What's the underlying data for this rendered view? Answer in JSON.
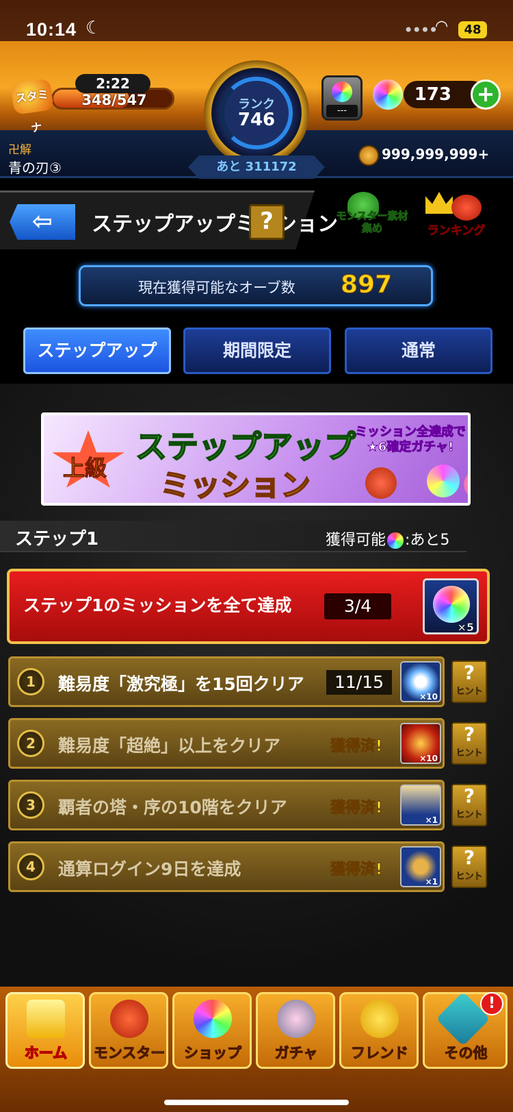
{
  "status_bar": {
    "time": "10:14",
    "battery": "48"
  },
  "header": {
    "stamina_label": "スタミナ",
    "stamina_timer": "2:22",
    "stamina_value": "348/547",
    "stamina_fraction": 0.64,
    "rank_label": "ランク",
    "rank_value": "746",
    "next_rank": "あと 311172",
    "slot_text": "---",
    "orb_count": "173",
    "plus": "+",
    "title_top": "卍解",
    "title_name": "青の刃③",
    "gold": "999,999,999+"
  },
  "page": {
    "back": "⇦",
    "title": "ステップアップミッション",
    "help": "?",
    "badge_left": "モンスター素材集め",
    "badge_right": "ランキング"
  },
  "orb_info": {
    "label": "現在獲得可能なオーブ数",
    "value": "897"
  },
  "tabs": [
    {
      "label": "ステップアップ",
      "active": true
    },
    {
      "label": "期間限定",
      "active": false
    },
    {
      "label": "通常",
      "active": false
    }
  ],
  "banner": {
    "rank": "上級",
    "title1": "ステップアップ",
    "title2": "ミッション",
    "subtitle": "ミッション全達成で★6確定ガチャ!"
  },
  "step": {
    "label": "ステップ1",
    "remain_prefix": "獲得可能",
    "remain_suffix": ":あと5"
  },
  "main_mission": {
    "label": "ステップ1のミッションを全て達成",
    "progress": "3/4",
    "reward": "×5"
  },
  "missions": [
    {
      "num": "1",
      "label": "難易度「激究極」を15回クリア",
      "progress": "11/15",
      "status": "",
      "reward": "×10"
    },
    {
      "num": "2",
      "label": "難易度「超絶」以上をクリア",
      "progress": "",
      "status": "獲得済!",
      "reward": "×10"
    },
    {
      "num": "3",
      "label": "覇者の塔・序の10階をクリア",
      "progress": "",
      "status": "獲得済!",
      "reward": "×1"
    },
    {
      "num": "4",
      "label": "通算ログイン9日を達成",
      "progress": "",
      "status": "獲得済!",
      "reward": "×1"
    }
  ],
  "hint": {
    "q": "?",
    "label": "ヒント"
  },
  "nav": [
    {
      "label": "ホーム"
    },
    {
      "label": "モンスター"
    },
    {
      "label": "ショップ"
    },
    {
      "label": "ガチャ"
    },
    {
      "label": "フレンド"
    },
    {
      "label": "その他"
    }
  ],
  "nav_badge": "!"
}
